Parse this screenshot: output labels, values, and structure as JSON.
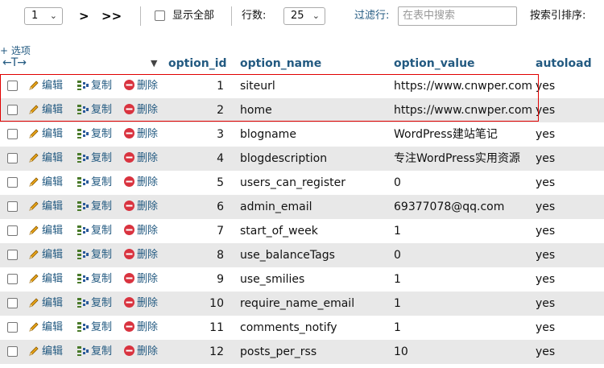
{
  "toolbar": {
    "page_select_value": "1",
    "next_label": ">",
    "last_label": ">>",
    "show_all_label": "显示全部",
    "rows_label": "行数:",
    "rows_value": "25",
    "filter_label": "过滤行:",
    "filter_placeholder": "在表中搜索",
    "sort_by_index_label": "按索引排序:"
  },
  "options_link": "+ 选项",
  "columns": {
    "option_id": "option_id",
    "option_name": "option_name",
    "option_value": "option_value",
    "autoload": "autoload"
  },
  "actions": {
    "edit": "编辑",
    "copy": "复制",
    "delete": "删除"
  },
  "rows": [
    {
      "id": "1",
      "name": "siteurl",
      "value": "https://www.cnwper.com",
      "autoload": "yes"
    },
    {
      "id": "2",
      "name": "home",
      "value": "https://www.cnwper.com",
      "autoload": "yes"
    },
    {
      "id": "3",
      "name": "blogname",
      "value": "WordPress建站笔记",
      "autoload": "yes"
    },
    {
      "id": "4",
      "name": "blogdescription",
      "value": "专注WordPress实用资源",
      "autoload": "yes"
    },
    {
      "id": "5",
      "name": "users_can_register",
      "value": "0",
      "autoload": "yes"
    },
    {
      "id": "6",
      "name": "admin_email",
      "value": "69377078@qq.com",
      "autoload": "yes"
    },
    {
      "id": "7",
      "name": "start_of_week",
      "value": "1",
      "autoload": "yes"
    },
    {
      "id": "8",
      "name": "use_balanceTags",
      "value": "0",
      "autoload": "yes"
    },
    {
      "id": "9",
      "name": "use_smilies",
      "value": "1",
      "autoload": "yes"
    },
    {
      "id": "10",
      "name": "require_name_email",
      "value": "1",
      "autoload": "yes"
    },
    {
      "id": "11",
      "name": "comments_notify",
      "value": "1",
      "autoload": "yes"
    },
    {
      "id": "12",
      "name": "posts_per_rss",
      "value": "10",
      "autoload": "yes"
    }
  ],
  "colors": {
    "link": "#235a81",
    "row_alt": "#e8e8e8",
    "highlight": "#e00000",
    "delete_icon": "#d9333f",
    "edit_icon": "#e8a317"
  }
}
